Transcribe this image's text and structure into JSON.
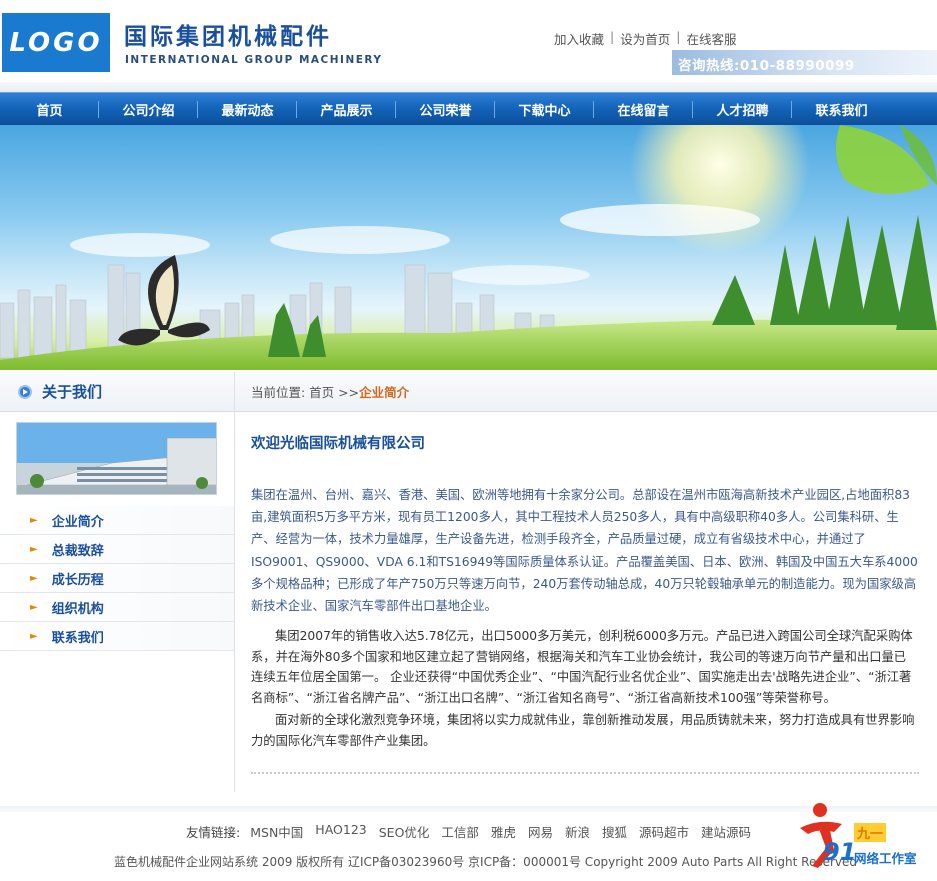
{
  "header": {
    "logo": "LOGO",
    "brand_cn": "国际集团机械配件",
    "brand_en": "INTERNATIONAL GROUP MACHINERY",
    "top_links": [
      "加入收藏",
      "设为首页",
      "在线客服"
    ],
    "hotline": "咨询热线:010-88990099"
  },
  "nav": [
    "首页",
    "公司介绍",
    "最新动态",
    "产品展示",
    "公司荣誉",
    "下载中心",
    "在线留言",
    "人才招聘",
    "联系我们"
  ],
  "sidebar": {
    "title": "关于我们",
    "items": [
      "企业简介",
      "总裁致辞",
      "成长历程",
      "组织机构",
      "联系我们"
    ]
  },
  "breadcrumb": {
    "prefix": "当前位置: 首页 >> ",
    "current": "企业简介"
  },
  "article": {
    "title": "欢迎光临国际机械有限公司",
    "p1": "集团在温州、台州、嘉兴、香港、美国、欧洲等地拥有十余家分公司。总部设在温州市瓯海高新技术产业园区,占地面积83亩,建筑面积5万多平方米，现有员工1200多人，其中工程技术人员250多人，具有中高级职称40多人。公司集科研、生产、经营为一体，技术力量雄厚，生产设备先进，检测手段齐全，产品质量过硬，成立有省级技术中心，并通过了ISO9001、QS9000、VDA 6.1和TS16949等国际质量体系认证。产品覆盖美国、日本、欧洲、韩国及中国五大车系4000多个规格品种；已形成了年产750万只等速万向节，240万套传动轴总成，40万只轮毂轴承单元的制造能力。现为国家级高新技术企业、国家汽车零部件出口基地企业。",
    "p2": "集团2007年的销售收入达5.78亿元，出口5000多万美元，创利税6000多万元。产品已进入跨国公司全球汽配采购体系，并在海外80多个国家和地区建立起了营销网络，根据海关和汽车工业协会统计，我公司的等速万向节产量和出口量已连续五年位居全国第一。 企业还获得“中国优秀企业”、“中国汽配行业名优企业”、国实施走出去'战略先进企业”、“浙江著名商标”、“浙江省名牌产品”、“浙江出口名牌”、“浙江省知名商号”、“浙江省高新技术100强”等荣誉称号。",
    "p3": "面对新的全球化激烈竞争环境，集团将以实力成就伟业，靠创新推动发展，用品质铸就未来，努力打造成具有世界影响力的国际化汽车零部件产业集团。"
  },
  "footer": {
    "friend_label": "友情链接:",
    "friend_links": [
      "MSN中国",
      "HAO123",
      "SEO优化",
      "工信部",
      "雅虎",
      "网易",
      "新浪",
      "搜狐",
      "源码超市",
      "建站源码"
    ],
    "copyright": "蓝色机械配件企业网站系统 2009 版权所有 辽ICP备03023960号 京ICP备：000001号 Copyright 2009 Auto Parts All Right Reserved"
  },
  "watermark": {
    "number": "91",
    "cn": "九一",
    "sub": "网络工作室"
  },
  "colors": {
    "nav_blue": "#1262b8",
    "title_blue": "#1a4f9c",
    "accent_orange": "#d2691e"
  }
}
